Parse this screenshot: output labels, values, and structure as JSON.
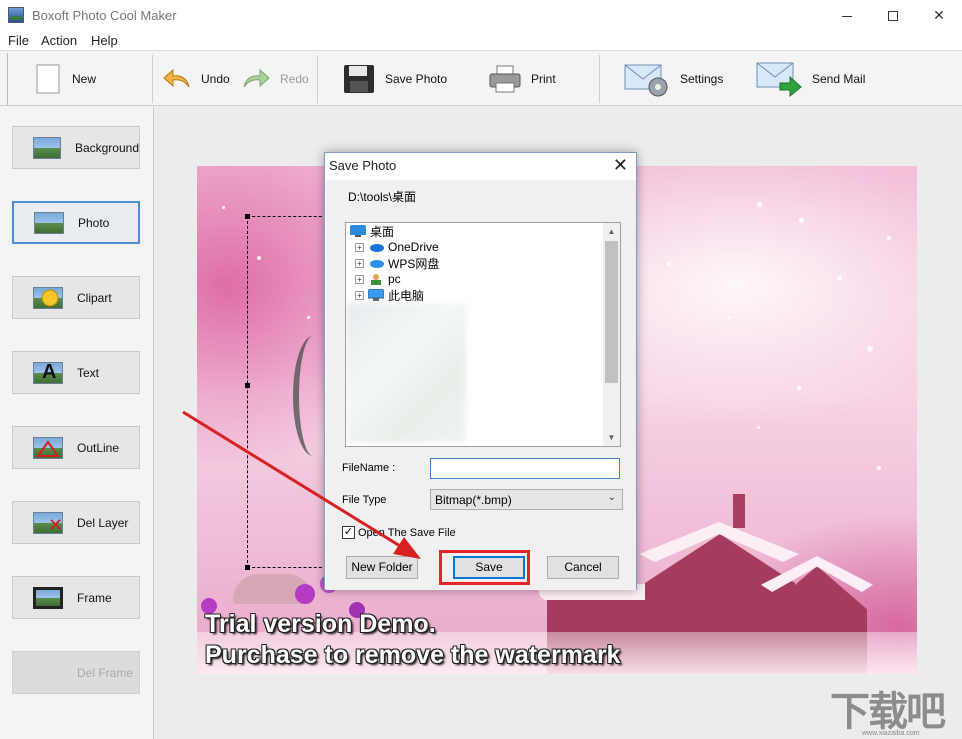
{
  "window": {
    "title": "Boxoft Photo Cool Maker",
    "minimize": "",
    "maximize": "",
    "close": "✕"
  },
  "menu": [
    "File",
    "Action",
    "Help"
  ],
  "toolbar": {
    "new": "New",
    "undo": "Undo",
    "redo": "Redo",
    "save_photo": "Save Photo",
    "print": "Print",
    "settings": "Settings",
    "send_mail": "Send Mail"
  },
  "sidebar": [
    "Background",
    "Photo",
    "Clipart",
    "Text",
    "OutLine",
    "Del Layer",
    "Frame",
    "Del Frame"
  ],
  "canvas": {
    "watermark_line1": "Trial version Demo.",
    "watermark_line2": "Purchase to remove the watermark"
  },
  "dialog": {
    "title": "Save Photo",
    "close": "✕",
    "path": "D:\\tools\\桌面",
    "tree": {
      "root": "桌面",
      "items": [
        "OneDrive",
        "WPS网盘",
        "pc",
        "此电脑"
      ]
    },
    "filename_label": "FileName :",
    "filename_value": "",
    "filetype_label": "File Type",
    "filetype_value": "Bitmap(*.bmp)",
    "open_checkbox_label": "Open The Save File",
    "open_checked": true,
    "new_folder": "New  Folder",
    "save": "Save",
    "cancel": "Cancel"
  },
  "watermark_logo": {
    "text": "下载吧",
    "url": "www.xiazaiba.com"
  },
  "colors": {
    "accent": "#0078d7",
    "highlight": "#e0262a",
    "photo_pink": "#f3bfd8"
  }
}
